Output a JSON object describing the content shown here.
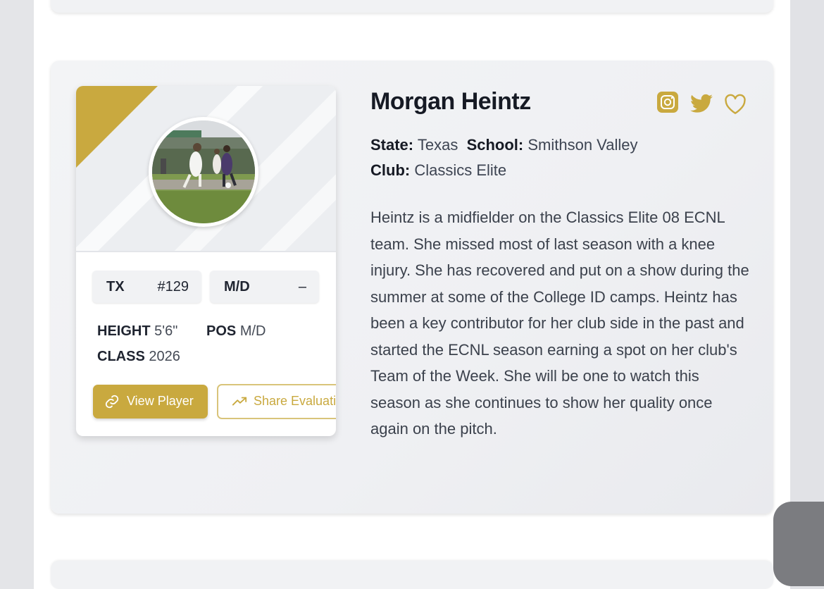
{
  "player": {
    "name": "Morgan Heintz",
    "state_label": "State:",
    "state": "Texas",
    "school_label": "School:",
    "school": "Smithson Valley",
    "club_label": "Club:",
    "club": "Classics Elite",
    "bio": "Heintz is a midfielder on the Classics Elite 08 ECNL team. She missed most of last season with a knee injury. She has recovered and put on a show during the summer at some of the College ID camps. Heintz has been a key contributor for her club side in the past and started the ECNL season earning a spot on her club's Team of the Week. She will be one to watch this season as she continues to show her quality once again on the pitch."
  },
  "card": {
    "rank_state": "TX",
    "rank_number": "#129",
    "position_pill": "M/D",
    "position_rank": "–",
    "height_label": "HEIGHT",
    "height": "5'6\"",
    "pos_label": "POS",
    "pos": "M/D",
    "class_label": "CLASS",
    "class_year": "2026",
    "view_button": "View Player",
    "share_button": "Share Evaluation"
  },
  "icons": {
    "instagram": "instagram-icon",
    "twitter": "twitter-icon",
    "favorite": "heart-icon",
    "link": "link-icon",
    "trending": "trending-up-icon"
  },
  "colors": {
    "accent": "#c9a93f",
    "card_background": "#f1f2f4",
    "text_dark": "#161a24"
  }
}
